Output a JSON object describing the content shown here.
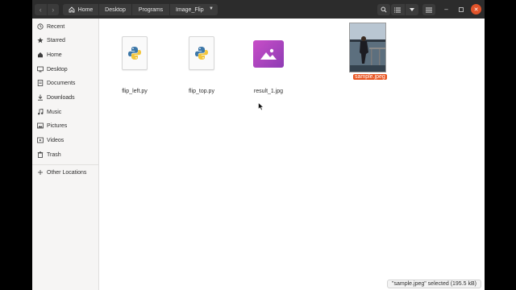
{
  "breadcrumb": {
    "items": [
      {
        "label": "Home"
      },
      {
        "label": "Desktop"
      },
      {
        "label": "Programs"
      },
      {
        "label": "Image_Flip"
      }
    ]
  },
  "sidebar": {
    "items": [
      {
        "label": "Recent",
        "icon": "clock-icon"
      },
      {
        "label": "Starred",
        "icon": "star-icon"
      },
      {
        "label": "Home",
        "icon": "home-icon"
      },
      {
        "label": "Desktop",
        "icon": "desktop-icon"
      },
      {
        "label": "Documents",
        "icon": "document-icon"
      },
      {
        "label": "Downloads",
        "icon": "download-icon"
      },
      {
        "label": "Music",
        "icon": "music-icon"
      },
      {
        "label": "Pictures",
        "icon": "picture-icon"
      },
      {
        "label": "Videos",
        "icon": "video-icon"
      },
      {
        "label": "Trash",
        "icon": "trash-icon"
      }
    ],
    "other": {
      "label": "Other Locations",
      "icon": "plus-icon"
    }
  },
  "files": [
    {
      "name": "flip_left.py",
      "type": "python-file"
    },
    {
      "name": "flip_top.py",
      "type": "python-file"
    },
    {
      "name": "result_1.jpg",
      "type": "image-file"
    },
    {
      "name": "sample.jpeg",
      "type": "photo",
      "selected": true
    }
  ],
  "status": {
    "text": "\"sample.jpeg\" selected  (195.5 kB)"
  },
  "colors": {
    "accent": "#e95420",
    "headerbar": "#2c2c2c",
    "sidebar": "#f6f5f4"
  }
}
